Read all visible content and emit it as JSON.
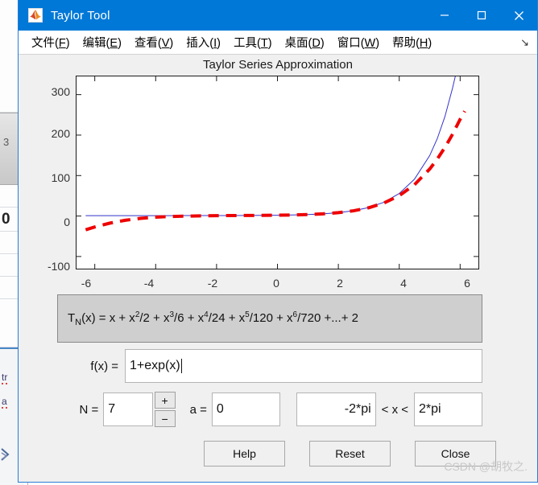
{
  "window": {
    "title": "Taylor Tool",
    "app_icon": "matlab-membrane-icon",
    "titlebar_color": "#0078d7",
    "controls": {
      "minimize": "minimize-icon",
      "maximize": "maximize-icon",
      "close": "close-icon"
    }
  },
  "menubar": {
    "items": [
      {
        "label": "文件",
        "mnemonic": "F"
      },
      {
        "label": "编辑",
        "mnemonic": "E"
      },
      {
        "label": "查看",
        "mnemonic": "V"
      },
      {
        "label": "插入",
        "mnemonic": "I"
      },
      {
        "label": "工具",
        "mnemonic": "T"
      },
      {
        "label": "桌面",
        "mnemonic": "D"
      },
      {
        "label": "窗口",
        "mnemonic": "W"
      },
      {
        "label": "帮助",
        "mnemonic": "H"
      }
    ],
    "overflow_icon": "menu-overflow-arrow-icon"
  },
  "chart_data": {
    "type": "line",
    "title": "Taylor Series Approximation",
    "xlabel": "",
    "ylabel": "",
    "xlim": [
      -6.6,
      6.6
    ],
    "ylim": [
      -130,
      345
    ],
    "xticks": [
      -6,
      -4,
      -2,
      0,
      2,
      4,
      6
    ],
    "yticks": [
      -100,
      0,
      100,
      200,
      300
    ],
    "xticklabels": [
      "-6",
      "-4",
      "-2",
      "0",
      "2",
      "4",
      "6"
    ],
    "yticklabels": [
      "-100",
      "0",
      "100",
      "200",
      "300"
    ],
    "grid": false,
    "legend": false,
    "series": [
      {
        "name": "f(x) = 1+exp(x)",
        "style": "solid",
        "color": "#3333cc",
        "width": 1,
        "x": [
          -6.3,
          -6,
          -5.5,
          -5,
          -4.5,
          -4,
          -3.5,
          -3,
          -2.5,
          -2,
          -1.5,
          -1,
          -0.5,
          0,
          0.5,
          1,
          1.5,
          2,
          2.5,
          3,
          3.5,
          4,
          4.5,
          5,
          5.25,
          5.5,
          5.75,
          5.85
        ],
        "y": [
          1.0,
          1.0,
          1.0,
          1.01,
          1.01,
          1.02,
          1.03,
          1.05,
          1.08,
          1.14,
          1.22,
          1.37,
          1.61,
          2.0,
          2.65,
          3.72,
          5.48,
          8.39,
          13.18,
          21.09,
          34.12,
          55.6,
          91.0,
          149.4,
          191.5,
          245.7,
          315.9,
          348.0
        ]
      },
      {
        "name": "T_N(x)",
        "style": "dashed",
        "color": "#ee0000",
        "width": 4,
        "x": [
          -6.3,
          -6,
          -5.5,
          -5,
          -4.5,
          -4,
          -3.5,
          -3,
          -2.5,
          -2,
          -1.5,
          -1,
          -0.5,
          0,
          0.5,
          1,
          1.5,
          2,
          2.5,
          3,
          3.5,
          4,
          4.5,
          5,
          5.25,
          5.5,
          5.75,
          6.0,
          6.15
        ],
        "y": [
          -34.0,
          -27.0,
          -17.5,
          -10.5,
          -5.8,
          -2.8,
          -1.1,
          -0.2,
          0.4,
          0.9,
          1.18,
          1.37,
          1.61,
          2.0,
          2.65,
          3.72,
          5.47,
          8.36,
          13.0,
          20.5,
          32.3,
          50.4,
          77.4,
          116.1,
          140.9,
          169.4,
          202.0,
          239.0,
          259.0
        ]
      }
    ]
  },
  "formula": {
    "prefix": "T",
    "subscript": "N",
    "body": "(x) = x + x²/2 + x³/6 + x⁴/24 + x⁵/120 + x⁶/720 +...+ 2",
    "full_text": "T_N(x) = x + x^2/2 + x^3/6 + x^4/24 + x^5/120 + x^6/720 +...+ 2",
    "terms": [
      {
        "numerator": "x",
        "power": "",
        "denominator": ""
      },
      {
        "numerator": "x",
        "power": "2",
        "denominator": "2"
      },
      {
        "numerator": "x",
        "power": "3",
        "denominator": "6"
      },
      {
        "numerator": "x",
        "power": "4",
        "denominator": "24"
      },
      {
        "numerator": "x",
        "power": "5",
        "denominator": "120"
      },
      {
        "numerator": "x",
        "power": "6",
        "denominator": "720"
      }
    ],
    "tail": "+...+ 2"
  },
  "inputs": {
    "fx_label": "f(x) =",
    "fx_value": "1+exp(x)",
    "n_label": "N =",
    "n_value": "7",
    "stepper_up": "+",
    "stepper_down": "−",
    "a_label": "a =",
    "a_value": "0",
    "range_lower": "-2*pi",
    "range_operator_left": "< x <",
    "range_upper": "2*pi"
  },
  "buttons": {
    "help": "Help",
    "reset": "Reset",
    "close": "Close"
  },
  "watermark": {
    "text": "CSDN @胡牧之."
  },
  "background_window": {
    "fragments": [
      "3",
      "0",
      "tr",
      "a"
    ]
  }
}
